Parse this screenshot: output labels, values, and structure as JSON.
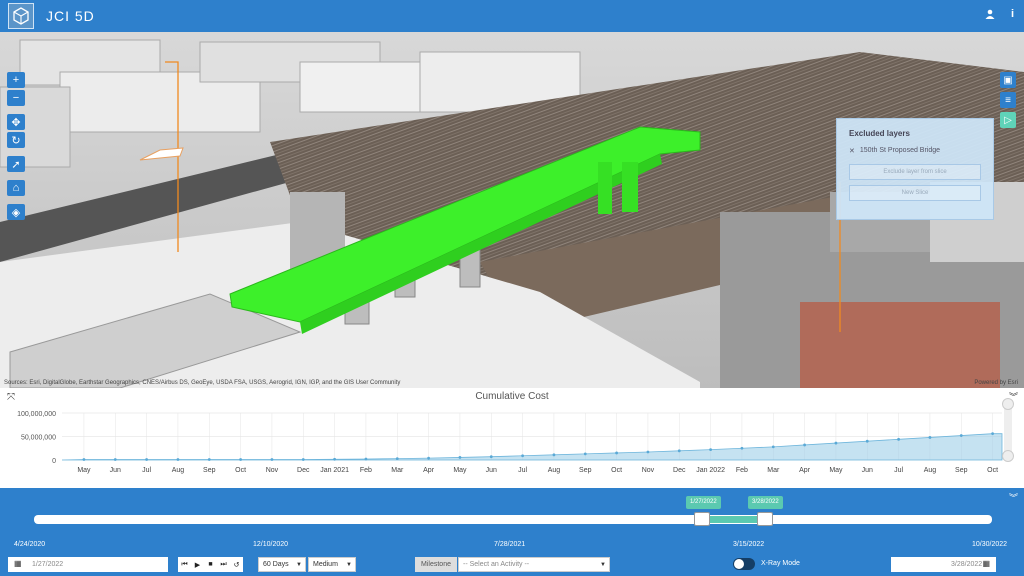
{
  "app": {
    "title": "JCI 5D"
  },
  "header": {
    "user_icon": "user-icon",
    "info_icon": "info-icon"
  },
  "map": {
    "attribution": "Sources: Esri, DigitalGlobe, Earthstar Geographics, CNES/Airbus DS, GeoEye, USDA FSA, USGS, Aerogrid, IGN, IGP, and the GIS User Community",
    "powered_by": "Powered by Esri",
    "bridge_color": "#3df02a",
    "layers_panel": {
      "title": "Excluded layers",
      "item": "150th St Proposed Bridge",
      "exclude_button": "Exclude layer from slice",
      "new_slice_button": "New Slice"
    }
  },
  "chart_data": {
    "type": "area",
    "title": "Cumulative Cost",
    "y_ticks": [
      "100,000,000",
      "50,000,000",
      "0"
    ],
    "ylim": [
      0,
      100000000
    ],
    "x_tick_labels": [
      "May",
      "Jun",
      "Jul",
      "Aug",
      "Sep",
      "Oct",
      "Nov",
      "Dec",
      "Jan 2021",
      "Feb",
      "Mar",
      "Apr",
      "May",
      "Jun",
      "Jul",
      "Aug",
      "Sep",
      "Oct",
      "Nov",
      "Dec",
      "Jan 2022",
      "Feb",
      "Mar",
      "Apr",
      "May",
      "Jun",
      "Jul",
      "Aug",
      "Sep",
      "Oct"
    ],
    "series": [
      {
        "values": [
          1000000,
          1000000,
          1000000,
          1000000,
          1000000,
          1000000,
          1000000,
          1000000,
          1500000,
          2000000,
          3000000,
          4000000,
          5500000,
          7000000,
          9000000,
          11000000,
          13000000,
          15000000,
          17000000,
          19500000,
          22000000,
          25000000,
          28000000,
          32000000,
          36000000,
          40000000,
          44000000,
          48000000,
          52000000,
          56000000
        ]
      }
    ],
    "color": "#9fcfe8",
    "grid": true
  },
  "timeline": {
    "start_label": "4/24/2020",
    "tick_labels": [
      "12/10/2020",
      "7/28/2021",
      "3/15/2022"
    ],
    "end_label": "10/30/2022",
    "range_start_flag": "1/27/2022",
    "range_end_flag": "3/28/2022",
    "range_start_fraction": 0.7,
    "range_end_fraction": 0.76,
    "accent_color": "#5bc9b0"
  },
  "controls": {
    "start_date": "1/27/2022",
    "end_date": "3/28/2022",
    "interval": "60 Days",
    "speed": "Medium",
    "milestone_label": "Milestone",
    "activity_placeholder": "-- Select an Activity --",
    "xray_label": "X-Ray Mode"
  }
}
